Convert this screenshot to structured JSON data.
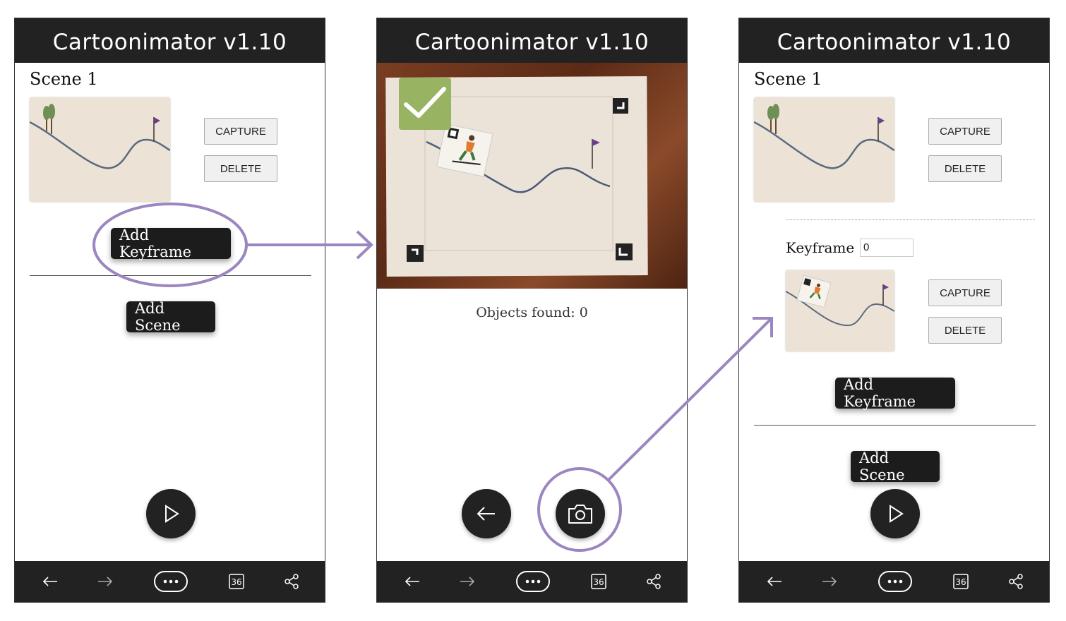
{
  "app": {
    "title": "Cartoonimator v1.10"
  },
  "screen1": {
    "scene_label": "Scene 1",
    "capture_label": "CAPTURE",
    "delete_label": "DELETE",
    "add_keyframe_label": "Add Keyframe",
    "add_scene_label": "Add Scene"
  },
  "screen2": {
    "objects_found": "Objects found: 0"
  },
  "screen3": {
    "scene_label": "Scene 1",
    "capture_label": "CAPTURE",
    "delete_label": "DELETE",
    "keyframe_label": "Keyframe",
    "keyframe_value": "0",
    "capture2_label": "CAPTURE",
    "delete2_label": "DELETE",
    "add_keyframe_label": "Add Keyframe",
    "add_scene_label": "Add Scene"
  },
  "bottom_bar": {
    "tab_count": "36",
    "icons": [
      "back-arrow-icon",
      "forward-arrow-icon",
      "more-icon",
      "tabs-icon",
      "share-icon"
    ]
  },
  "colors": {
    "accent_annotation": "#9c86c0",
    "bar": "#222222",
    "check_green": "#8fae55"
  }
}
